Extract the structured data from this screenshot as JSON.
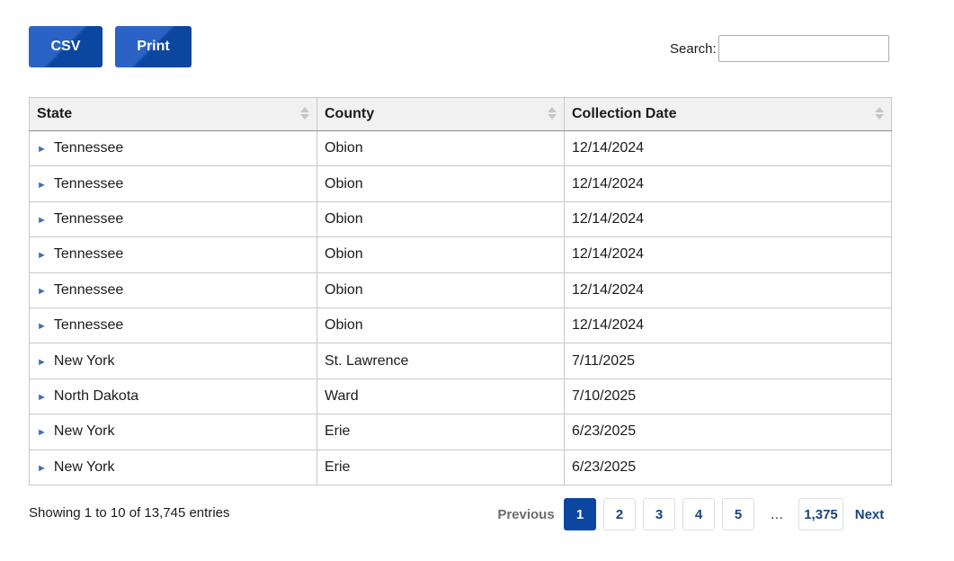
{
  "toolbar": {
    "csv_label": "CSV",
    "print_label": "Print"
  },
  "search": {
    "label": "Search:",
    "value": ""
  },
  "table": {
    "headers": [
      "State",
      "County",
      "Collection Date"
    ],
    "rows": [
      [
        "Tennessee",
        "Obion",
        "12/14/2024"
      ],
      [
        "Tennessee",
        "Obion",
        "12/14/2024"
      ],
      [
        "Tennessee",
        "Obion",
        "12/14/2024"
      ],
      [
        "Tennessee",
        "Obion",
        "12/14/2024"
      ],
      [
        "Tennessee",
        "Obion",
        "12/14/2024"
      ],
      [
        "Tennessee",
        "Obion",
        "12/14/2024"
      ],
      [
        "New York",
        "St. Lawrence",
        "7/11/2025"
      ],
      [
        "North Dakota",
        "Ward",
        "7/10/2025"
      ],
      [
        "New York",
        "Erie",
        "6/23/2025"
      ],
      [
        "New York",
        "Erie",
        "6/23/2025"
      ]
    ],
    "expand_glyph": "►"
  },
  "info": "Showing 1 to 10 of 13,745 entries",
  "pagination": {
    "previous": "Previous",
    "pages": [
      "1",
      "2",
      "3",
      "4",
      "5"
    ],
    "ellipsis": "…",
    "last": "1,375",
    "next": "Next",
    "current": "1"
  },
  "colors": {
    "accent": "#0b47a1",
    "link": "#1a4480",
    "header_bg": "#f1f1f1"
  }
}
